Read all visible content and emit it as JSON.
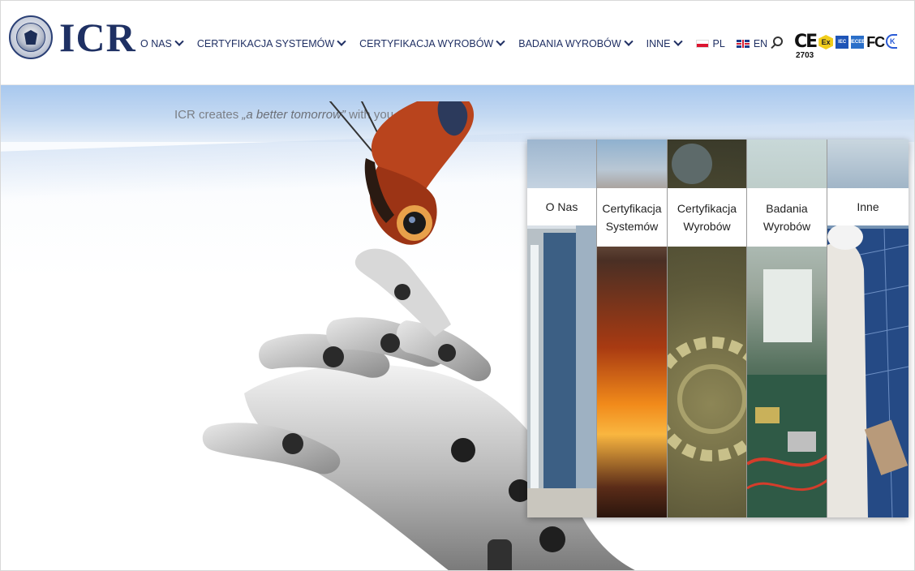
{
  "header": {
    "logo_text": "ICR",
    "nav": [
      {
        "label": "O NAS"
      },
      {
        "label": "CERTYFIKACJA SYSTEMÓW"
      },
      {
        "label": "CERTYFIKACJA WYROBÓW"
      },
      {
        "label": "BADANIA WYROBÓW"
      },
      {
        "label": "INNE"
      }
    ],
    "languages": [
      {
        "label": "PL"
      },
      {
        "label": "EN"
      }
    ],
    "marks": {
      "ce": "CE",
      "ce_number": "2703",
      "ex": "Ex",
      "iec": "IEC",
      "iecee": "IECEE",
      "fc": "FC",
      "kc": "K"
    }
  },
  "hero": {
    "slogan_prefix": "ICR creates ",
    "slogan_quote": "„a better tomorrow”",
    "slogan_suffix": " with you"
  },
  "panels": [
    {
      "line1": "O Nas",
      "line2": ""
    },
    {
      "line1": "Certyfikacja",
      "line2": "Systemów"
    },
    {
      "line1": "Certyfikacja",
      "line2": "Wyrobów"
    },
    {
      "line1": "Badania",
      "line2": "Wyrobów"
    },
    {
      "line1": "Inne",
      "line2": ""
    }
  ],
  "colors": {
    "brand_navy": "#1e3063",
    "sky": "#a8c8ee"
  },
  "icons": [
    "search-icon",
    "chevron-down-icon",
    "flag-pl-icon",
    "flag-en-icon"
  ]
}
